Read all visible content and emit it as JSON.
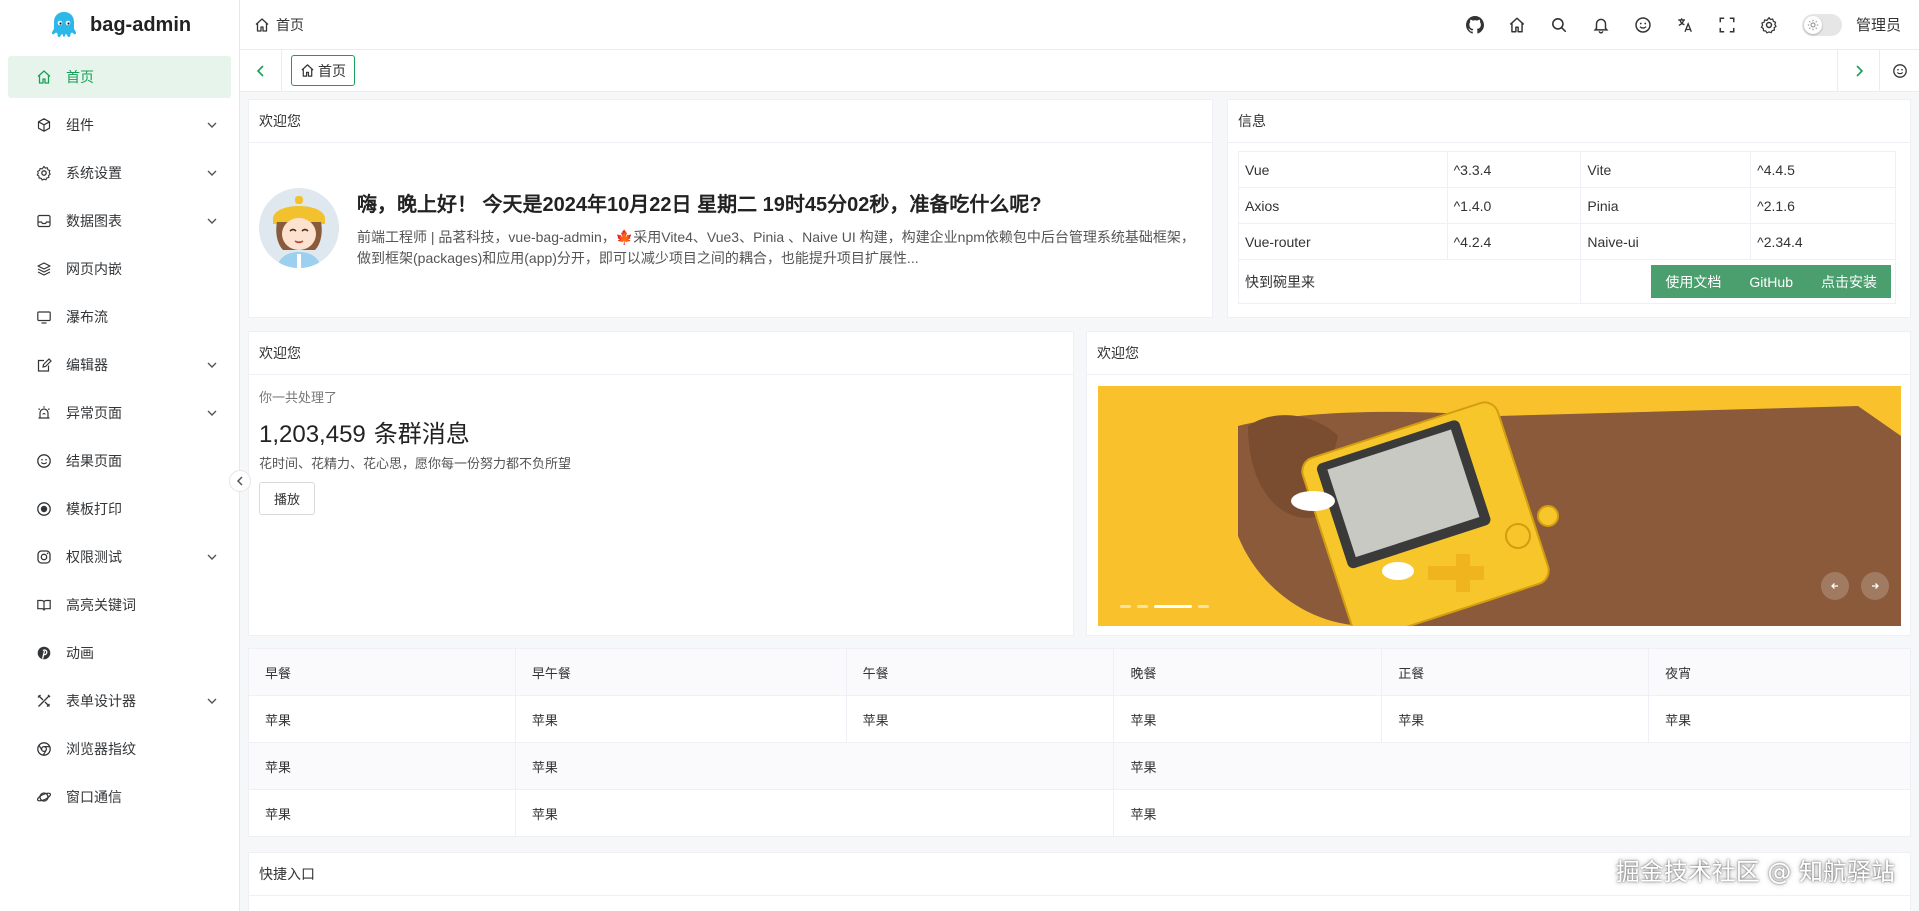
{
  "app": {
    "title": "bag-admin"
  },
  "sidebar": {
    "items": [
      {
        "label": "首页",
        "icon": "home-icon",
        "active": true,
        "expandable": false
      },
      {
        "label": "组件",
        "icon": "cube-icon",
        "active": false,
        "expandable": true
      },
      {
        "label": "系统设置",
        "icon": "gear-icon",
        "active": false,
        "expandable": true
      },
      {
        "label": "数据图表",
        "icon": "inbox-icon",
        "active": false,
        "expandable": true
      },
      {
        "label": "网页内嵌",
        "icon": "layers-icon",
        "active": false,
        "expandable": false
      },
      {
        "label": "瀑布流",
        "icon": "monitor-icon",
        "active": false,
        "expandable": false
      },
      {
        "label": "编辑器",
        "icon": "edit-icon",
        "active": false,
        "expandable": true
      },
      {
        "label": "异常页面",
        "icon": "alarm-icon",
        "active": false,
        "expandable": true
      },
      {
        "label": "结果页面",
        "icon": "smile-icon",
        "active": false,
        "expandable": false
      },
      {
        "label": "模板打印",
        "icon": "record-icon",
        "active": false,
        "expandable": false
      },
      {
        "label": "权限测试",
        "icon": "instagram-icon",
        "active": false,
        "expandable": true
      },
      {
        "label": "高亮关键词",
        "icon": "book-icon",
        "active": false,
        "expandable": false
      },
      {
        "label": "动画",
        "icon": "pinterest-icon",
        "active": false,
        "expandable": false
      },
      {
        "label": "表单设计器",
        "icon": "tools-icon",
        "active": false,
        "expandable": true
      },
      {
        "label": "浏览器指纹",
        "icon": "chrome-icon",
        "active": false,
        "expandable": false
      },
      {
        "label": "窗口通信",
        "icon": "planet-icon",
        "active": false,
        "expandable": false
      }
    ]
  },
  "header": {
    "breadcrumb": "首页",
    "user": "管理员",
    "tools": [
      "github-icon",
      "home-icon",
      "search-icon",
      "bell-icon",
      "smile-icon",
      "translate-icon",
      "fullscreen-icon",
      "gear-icon"
    ]
  },
  "tabs": {
    "items": [
      {
        "label": "首页"
      }
    ]
  },
  "welcome": {
    "title": "欢迎您",
    "greeting": "嗨，晚上好！ 今天是2024年10月22日 星期二 19时45分02秒，准备吃什么呢?",
    "description": "前端工程师 | 品茗科技，vue-bag-admin，🍁采用Vite4、Vue3、Pinia 、Naive UI 构建，构建企业npm依赖包中后台管理系统基础框架，做到框架(packages)和应用(app)分开，即可以减少项目之间的耦合，也能提升项目扩展性..."
  },
  "info": {
    "title": "信息",
    "rows": [
      [
        "Vue",
        "^3.3.4",
        "Vite",
        "^4.4.5"
      ],
      [
        "Axios",
        "^1.4.0",
        "Pinia",
        "^2.1.6"
      ],
      [
        "Vue-router",
        "^4.2.4",
        "Naive-ui",
        "^2.34.4"
      ]
    ],
    "footer_label": "快到碗里来",
    "links": [
      "使用文档",
      "GitHub",
      "点击安装"
    ]
  },
  "stats": {
    "title": "欢迎您",
    "subtitle": "你一共处理了",
    "count": "1,203,459",
    "unit": "条群消息",
    "note": "花时间、花精力、花心思，愿你每一份努力都不负所望",
    "button": "播放"
  },
  "carousel": {
    "title": "欢迎您",
    "slide_count": 4,
    "active_index": 2
  },
  "meals": {
    "headers": [
      "早餐",
      "早午餐",
      "午餐",
      "晚餐",
      "正餐",
      "夜宵"
    ],
    "row1": [
      "苹果",
      "苹果",
      "苹果",
      "苹果",
      "苹果",
      "苹果"
    ],
    "row2": [
      "苹果",
      "苹果",
      "苹果"
    ],
    "row3": [
      "苹果",
      "苹果",
      "苹果"
    ]
  },
  "shortcuts": {
    "title": "快捷入口"
  },
  "watermark": "掘金技术社区 @ 知航驿站",
  "colors": {
    "accent": "#18a058",
    "accent_bg": "#e7f4ec",
    "button_green": "#4b9e6d",
    "carousel_bg": "#f9c22d"
  }
}
